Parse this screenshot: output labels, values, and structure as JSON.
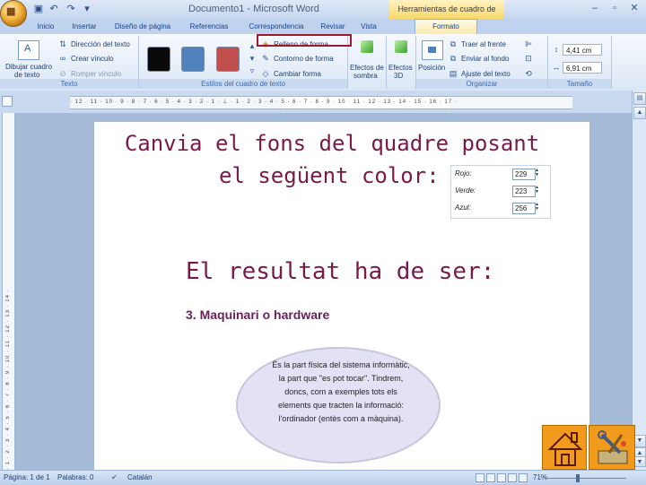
{
  "titlebar": {
    "window_title": "Documento1 - Microsoft Word",
    "context_tab_title": "Herramientas de cuadro de texto"
  },
  "tabs": [
    "Inicio",
    "Insertar",
    "Diseño de página",
    "Referencias",
    "Correspondencia",
    "Revisar",
    "Vista",
    "Formato"
  ],
  "ribbon": {
    "texto": {
      "group_label": "Texto",
      "draw_label_1": "Dibujar cuadro",
      "draw_label_2": "de texto",
      "direction": "Dirección del texto",
      "create_link": "Crear vínculo",
      "break_link": "Romper vínculo"
    },
    "styles": {
      "group_label": "Estilos del cuadro de texto",
      "swatches": [
        "#0a0a0a",
        "#4f81bd",
        "#c0504d"
      ],
      "fill": "Relleno de forma",
      "outline": "Contorno de forma",
      "change_shape": "Cambiar forma"
    },
    "shadow": {
      "label_1": "Efectos de",
      "label_2": "sombra"
    },
    "effects3d": {
      "label_1": "Efectos",
      "label_2": "3D"
    },
    "arrange": {
      "group_label": "Organizar",
      "position": "Posición",
      "bring_front": "Traer al frente",
      "send_back": "Enviar al fondo",
      "wrap_text": "Ajuste del texto"
    },
    "size": {
      "group_label": "Tamaño",
      "height": "4,41 cm",
      "width": "6,91 cm"
    }
  },
  "slide": {
    "instruction_line1": "Canvia el fons del quadre posant",
    "instruction_line2": "el següent color:",
    "color_rows": [
      {
        "label": "Rojo:",
        "value": "229"
      },
      {
        "label": "Verde:",
        "value": "223"
      },
      {
        "label": "Azul:",
        "value": "256"
      }
    ],
    "result_text": "El resultat ha de ser:",
    "section_heading": "3. Maquinari o hardware",
    "ellipse_text": "És la part física del sistema informàtic, la part que \"es pot tocar\". Tindrem, doncs, com a exemples tots els elements que tracten la informació: l'ordinador (entès com a màquina)."
  },
  "status": {
    "page": "Página: 1 de 1",
    "words": "Palabras: 0",
    "language": "Catalán",
    "zoom": "71%"
  },
  "colors": {
    "accent_text": "#7a1a4a",
    "nav_button": "#f29a1b",
    "highlight_border": "#9b1b30"
  }
}
